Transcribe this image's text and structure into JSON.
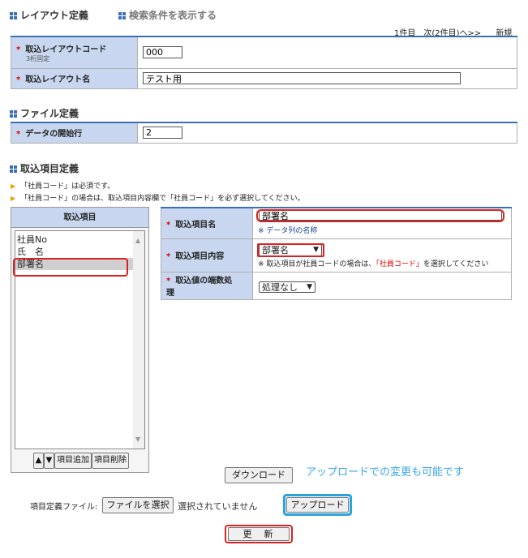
{
  "header": {
    "tab_layout": "レイアウト定義",
    "tab_search": "検索条件を表示する",
    "count": "1件目",
    "next": "次(2件目)へ>>",
    "new": "新規"
  },
  "layout_form": {
    "code_label": "取込レイアウトコード",
    "code_sub": "3桁固定",
    "code_value": "000",
    "name_label": "取込レイアウト名",
    "name_value": "テスト用"
  },
  "file_section": {
    "title": "ファイル定義",
    "start_row_label": "データの開始行",
    "start_row_value": "2"
  },
  "items_section": {
    "title": "取込項目定義",
    "note1": "「社員コード」は必須です。",
    "note2": "「社員コード」の場合は、取込項目内容欄で「社員コード」を必ず選択してください。",
    "list_header": "取込項目",
    "list_items": [
      "社員No",
      "氏　名",
      "部署名"
    ],
    "up_glyph": "▲",
    "down_glyph": "▼",
    "add_button": "項目追加",
    "delete_button": "項目削除"
  },
  "detail": {
    "item_name_label": "取込項目名",
    "item_name_value": "部署名",
    "item_name_hint": "※ データ列の名称",
    "content_label": "取込項目内容",
    "content_value": "部署名",
    "content_hint_a": "※ 取込項目が社員コードの場合は、",
    "content_hint_b": "「社員コード」",
    "content_hint_c": "を選択してください",
    "rounding_label_1": "取込値の端数処",
    "rounding_label_2": "理",
    "rounding_value": "処理なし"
  },
  "actions": {
    "download": "ダウンロード",
    "annotation": "アップロードでの変更も可能です",
    "file_label": "項目定義ファイル:",
    "choose_file": "ファイルを選択",
    "no_file": "選択されていません",
    "upload": "アップロード",
    "update": "更　新"
  },
  "colors": {
    "label_bg": "#c8d7ef",
    "accent": "#3a6fb4",
    "highlight_red": "#e02020",
    "highlight_blue": "#27a3e0"
  }
}
